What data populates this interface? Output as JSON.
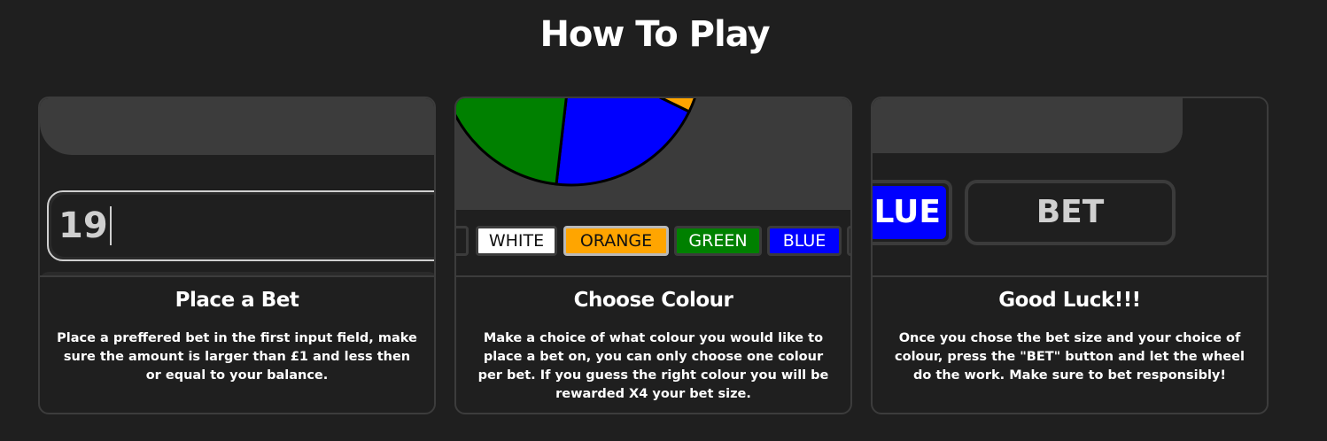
{
  "page": {
    "title": "How To Play"
  },
  "cards": [
    {
      "title": "Place a Bet",
      "description": "Place a preffered bet in the first input field, make sure the amount is larger than £1 and less then or equal to your balance.",
      "preview": {
        "bet_input_value": "19"
      }
    },
    {
      "title": "Choose Colour",
      "description": "Make a choice of what colour you would like to place a bet on, you can only choose one colour per bet. If you guess the right colour you will be rewarded X4 your bet size.",
      "preview": {
        "colour_buttons": [
          "WHITE",
          "ORANGE",
          "GREEN",
          "BLUE"
        ],
        "wheel_colors": {
          "green": "#008000",
          "blue": "#0000ff",
          "orange": "#ffa500"
        }
      }
    },
    {
      "title": "Good Luck!!!",
      "description": "Once you chose the bet size and your choice of colour, press the \"BET\" button and let the wheel do the work. Make sure to bet responsibly!",
      "preview": {
        "colour_button_partial": "LUE",
        "bet_button": "BET"
      }
    }
  ],
  "colors": {
    "background": "#1f1f1f",
    "card_border": "#3c3c3c",
    "accent_blue": "#0000ff",
    "accent_orange": "#ffa500",
    "accent_green": "#008000"
  }
}
